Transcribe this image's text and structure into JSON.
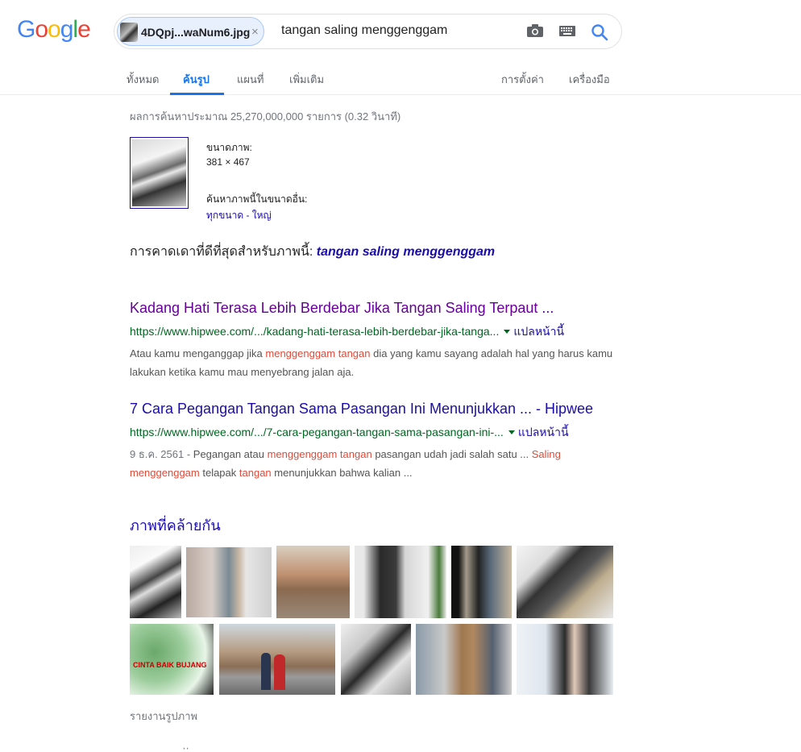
{
  "logo": {
    "letters": [
      "G",
      "o",
      "o",
      "g",
      "l",
      "e"
    ],
    "colors": [
      "#4285f4",
      "#ea4335",
      "#fbbc05",
      "#4285f4",
      "#34a853",
      "#ea4335"
    ]
  },
  "search": {
    "chip_name": "4DQpj...waNum6.jpg",
    "chip_close": "×",
    "query": "tangan saling menggenggam",
    "icons": [
      "camera-icon",
      "keyboard-icon",
      "search-icon"
    ]
  },
  "tabs": {
    "all": "ทั้งหมด",
    "images": "ค้นรูป",
    "maps": "แผนที่",
    "more": "เพิ่มเติม",
    "settings": "การตั้งค่า",
    "tools": "เครื่องมือ"
  },
  "stats": "ผลการค้นหาประมาณ 25,270,000,000 รายการ (0.32 วินาที)",
  "image_info": {
    "size_label": "ขนาดภาพ:",
    "size_value": "381 × 467",
    "other_sizes_label": "ค้นหาภาพนี้ในขนาดอื่น:",
    "other_sizes_link": "ทุกขนาด - ใหญ่"
  },
  "guess": {
    "label": "การคาดเดาที่ดีที่สุดสำหรับภาพนี้:",
    "value": "tangan saling menggenggam"
  },
  "results": [
    {
      "title": "Kadang Hati Terasa Lebih Berdebar Jika Tangan Saling Terpaut ...",
      "url": "https://www.hipwee.com/.../kadang-hati-terasa-lebih-berdebar-jika-tanga...",
      "translate": "แปลหน้านี้",
      "snippet": {
        "s1": "Atau kamu menganggap jika ",
        "h1": "menggenggam tangan",
        "s2": " dia yang kamu sayang adalah hal yang harus kamu lakukan ketika kamu mau menyebrang jalan aja."
      }
    },
    {
      "title": "7 Cara Pegangan Tangan Sama Pasangan Ini Menunjukkan ... - Hipwee",
      "url": "https://www.hipwee.com/.../7-cara-pegangan-tangan-sama-pasangan-ini-...",
      "translate": "แปลหน้านี้",
      "snippet": {
        "date": "9 ธ.ค. 2561 - ",
        "s1": "Pegangan atau ",
        "h1": "menggenggam tangan",
        "s2": " pasangan udah jadi salah satu ... ",
        "h2": "Saling",
        "h3": "menggenggam",
        "s3": " telapak ",
        "h4": "tangan",
        "s4": " menunjukkan bahwa kalian ..."
      }
    }
  ],
  "similar": {
    "heading": "ภาพที่คล้ายกัน",
    "overlay_text": "CINTA BAIK BUJANG",
    "report": "รายงานรูปภาพ"
  },
  "bottom_fragment": "่          ่"
}
